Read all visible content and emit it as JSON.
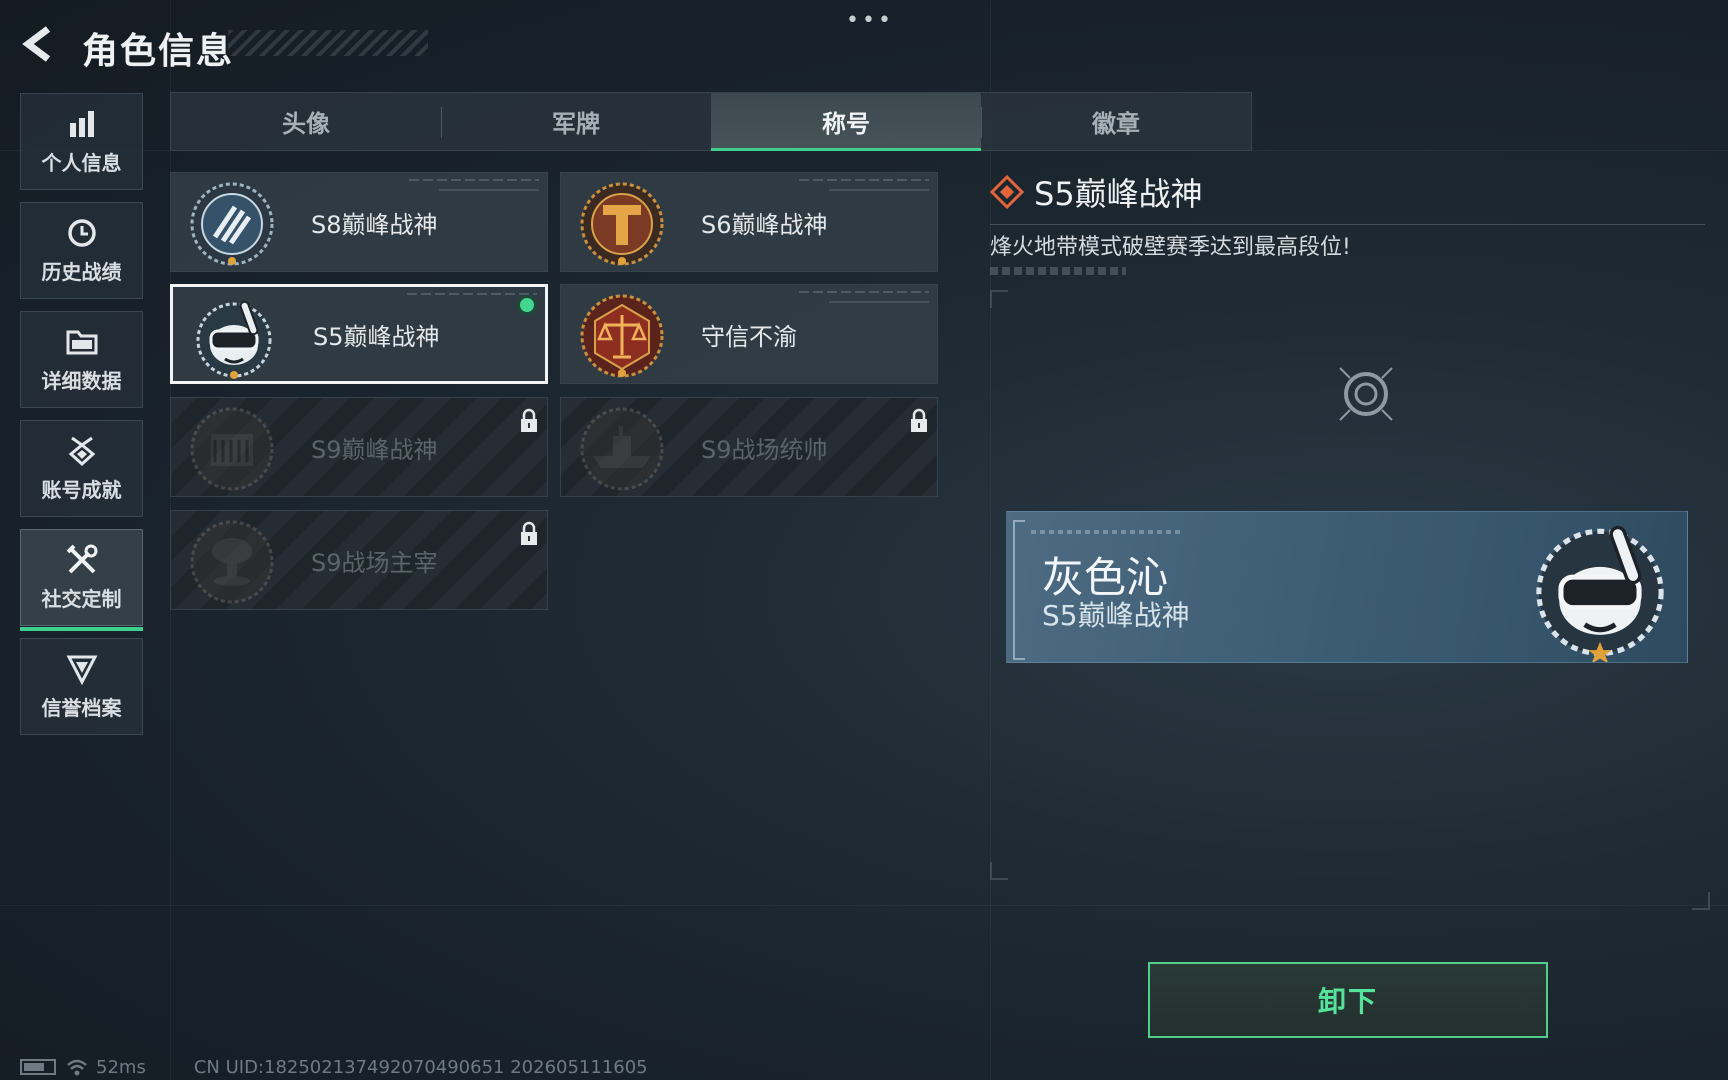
{
  "header": {
    "title": "角色信息",
    "menu_dots": "•••"
  },
  "sidebar": {
    "items": [
      {
        "label": "个人信息",
        "icon": "bar-chart-icon"
      },
      {
        "label": "历史战绩",
        "icon": "history-clock-icon"
      },
      {
        "label": "详细数据",
        "icon": "folder-icon"
      },
      {
        "label": "账号成就",
        "icon": "medal-icon"
      },
      {
        "label": "社交定制",
        "icon": "tools-icon",
        "active": true
      },
      {
        "label": "信誉档案",
        "icon": "shield-chevron-icon"
      }
    ]
  },
  "tabs": [
    {
      "label": "头像"
    },
    {
      "label": "军牌"
    },
    {
      "label": "称号",
      "active": true
    },
    {
      "label": "徽章"
    }
  ],
  "titles": [
    {
      "label": "S8巅峰战神",
      "badge": "s8-striped-emblem-icon",
      "locked": false
    },
    {
      "label": "S6巅峰战神",
      "badge": "s6-t-shield-emblem-icon",
      "locked": false
    },
    {
      "label": "S5巅峰战神",
      "badge": "diver-mask-emblem-icon",
      "locked": false,
      "selected": true,
      "equipped": true
    },
    {
      "label": "守信不渝",
      "badge": "scales-emblem-icon",
      "locked": false
    },
    {
      "label": "S9巅峰战神",
      "badge": "ruins-emblem-icon",
      "locked": true
    },
    {
      "label": "S9战场统帅",
      "badge": "warship-emblem-icon",
      "locked": true
    },
    {
      "label": "S9战场主宰",
      "badge": "mushroom-cloud-emblem-icon",
      "locked": true
    }
  ],
  "detail": {
    "title": "S5巅峰战神",
    "description": "烽火地带模式破壁赛季达到最高段位!"
  },
  "nameplate": {
    "player_name": "灰色沁",
    "title": "S5巅峰战神"
  },
  "actions": {
    "unequip_label": "卸下"
  },
  "status_bar": {
    "ping": "52ms",
    "uid": "CN UID:1825021374920704906​51 202605111605"
  },
  "colors": {
    "accent_green": "#3fcf8e",
    "button_text": "#54e39a",
    "nameplate_blue": "#3f5f76",
    "highlight_orange": "#e0653a"
  }
}
